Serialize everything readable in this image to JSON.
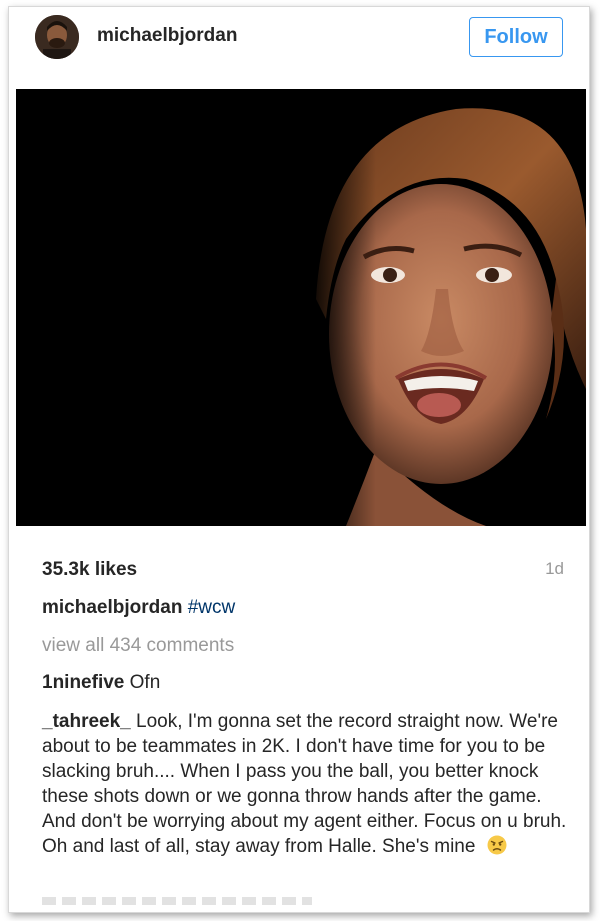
{
  "post": {
    "username": "michaelbjordan",
    "follow_label": "Follow",
    "likes": "35.3k likes",
    "time": "1d",
    "caption_user": "michaelbjordan",
    "caption_tag": "#wcw",
    "view_comments": "view all 434 comments"
  },
  "comments": [
    {
      "user": "1ninefive",
      "text": "Ofn"
    },
    {
      "user": "_tahreek_",
      "text": "Look, I'm gonna set the record straight now. We're about to be teammates in 2K. I don't have time for you to be slacking bruh.... When I pass you the ball, you better knock these shots down or we gonna throw hands after the game. And don't be worrying about my agent either. Focus on u bruh. Oh and last of all, stay away from Halle. She's mine"
    }
  ],
  "colors": {
    "follow_blue": "#3897f0",
    "hashtag_blue": "#003569",
    "muted_gray": "#999999"
  },
  "icons": {
    "emoji": "angry-face-icon"
  }
}
